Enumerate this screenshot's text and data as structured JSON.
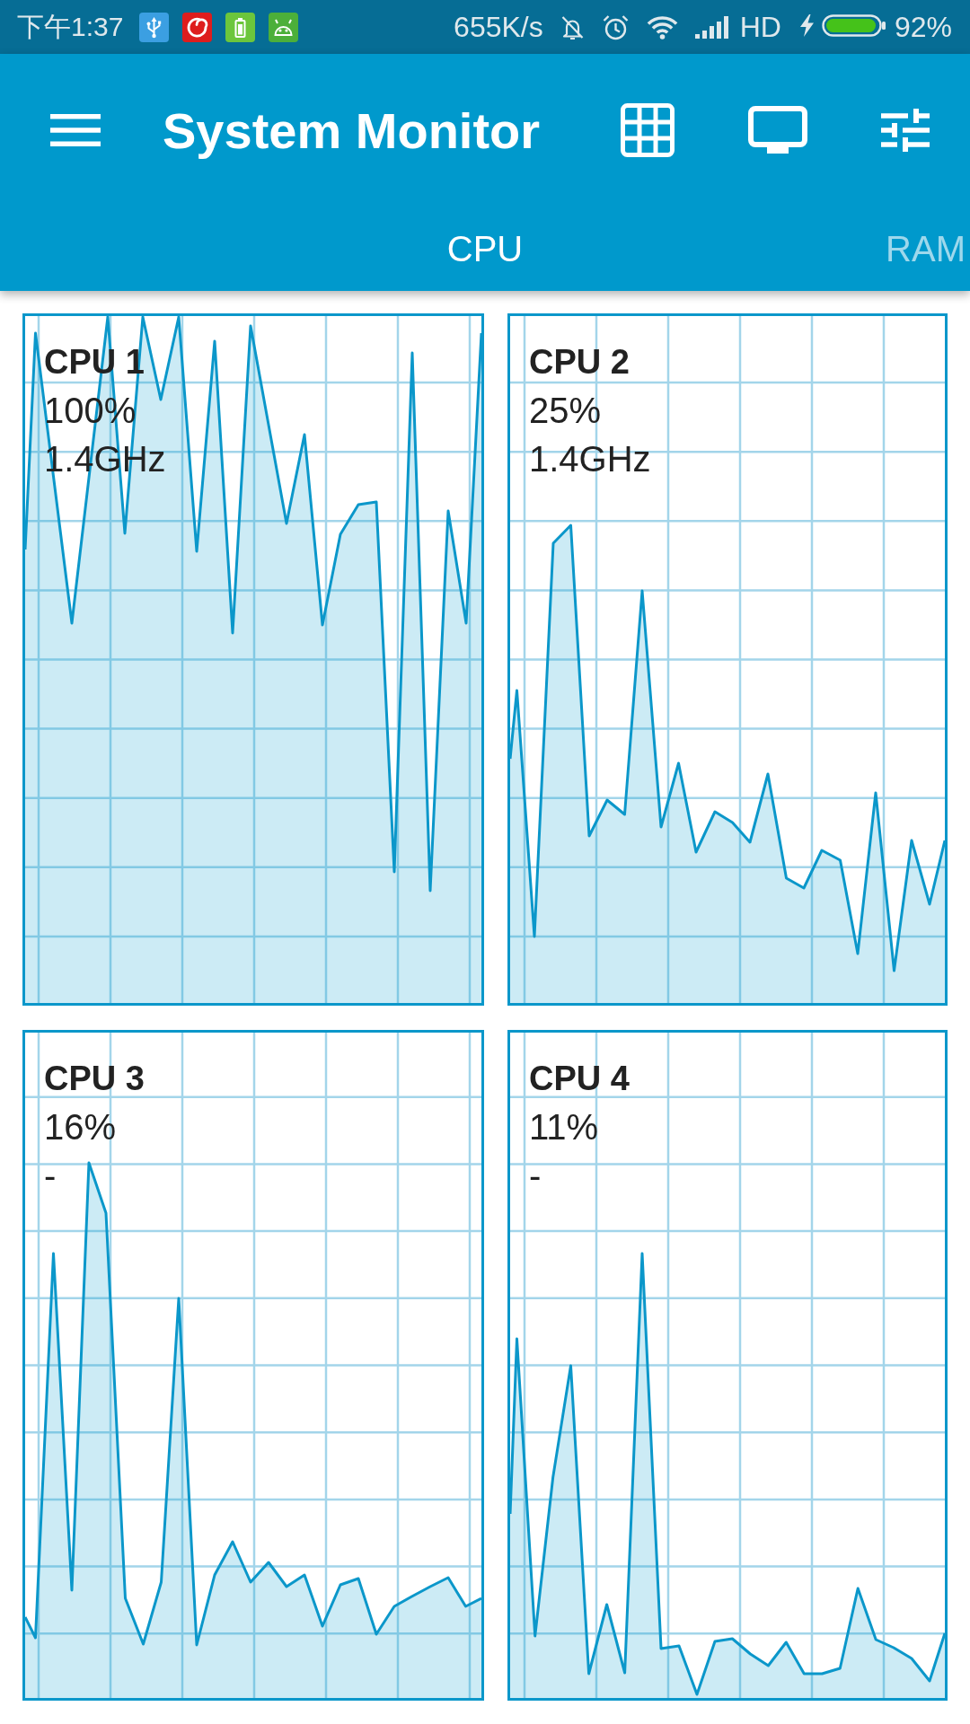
{
  "status_bar": {
    "time": "下午1:37",
    "network_speed": "655K/s",
    "network_type": "HD",
    "battery_percent": "92%"
  },
  "app_bar": {
    "title": "System Monitor"
  },
  "tabs": [
    {
      "label": "CPU",
      "selected": true
    },
    {
      "label": "RAM",
      "selected": false
    }
  ],
  "cores": [
    {
      "name": "CPU 1",
      "usage": "100%",
      "frequency": "1.4GHz"
    },
    {
      "name": "CPU 2",
      "usage": "25%",
      "frequency": "1.4GHz"
    },
    {
      "name": "CPU 3",
      "usage": "16%",
      "frequency": "-"
    },
    {
      "name": "CPU 4",
      "usage": "11%",
      "frequency": "-"
    }
  ]
}
